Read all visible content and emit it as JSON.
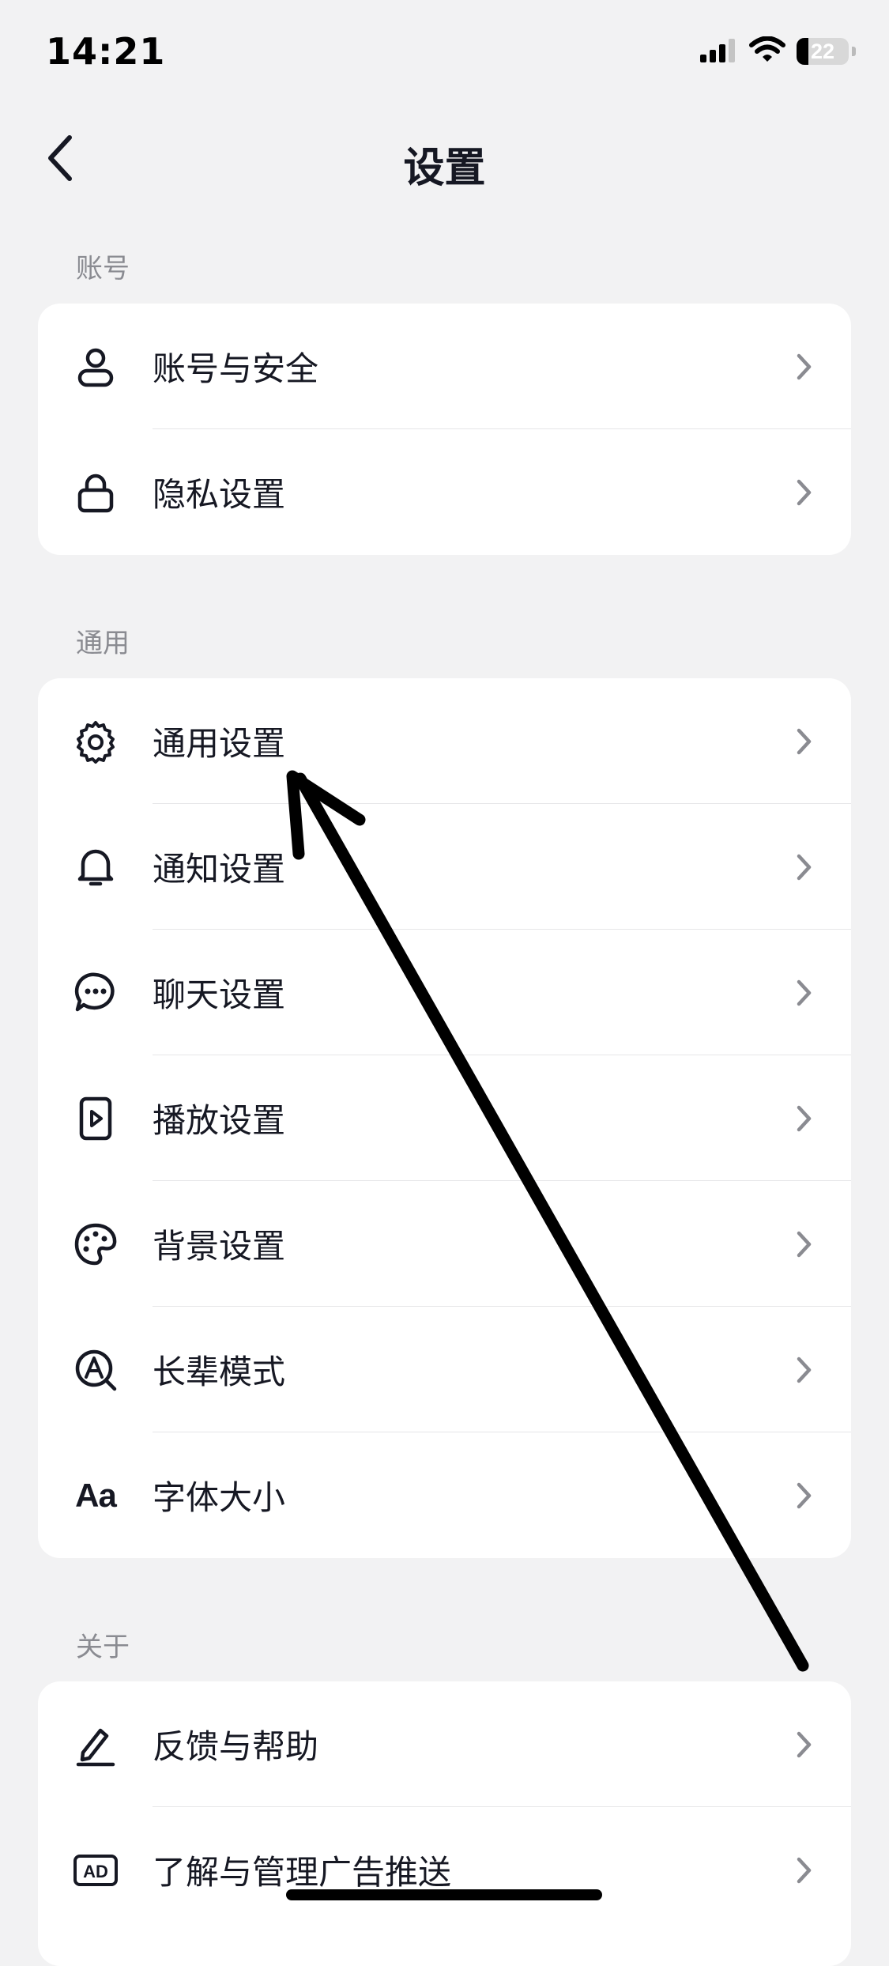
{
  "status_bar": {
    "time": "14:21",
    "battery": "22",
    "battery_level": 0.22,
    "signal_icon": "cellular-signal-icon",
    "wifi_icon": "wifi-icon"
  },
  "nav": {
    "title": "设置",
    "back_icon": "chevron-left-icon"
  },
  "sections": {
    "account": {
      "header": "账号",
      "items": [
        {
          "label": "账号与安全",
          "icon": "user-icon"
        },
        {
          "label": "隐私设置",
          "icon": "lock-icon"
        }
      ]
    },
    "general": {
      "header": "通用",
      "items": [
        {
          "label": "通用设置",
          "icon": "gear-icon"
        },
        {
          "label": "通知设置",
          "icon": "bell-icon"
        },
        {
          "label": "聊天设置",
          "icon": "chat-bubble-icon"
        },
        {
          "label": "播放设置",
          "icon": "play-icon"
        },
        {
          "label": "背景设置",
          "icon": "palette-icon"
        },
        {
          "label": "长辈模式",
          "icon": "elder-mode-icon"
        },
        {
          "label": "字体大小",
          "icon": "font-size-icon",
          "glyph": "Aa"
        }
      ]
    },
    "about": {
      "header": "关于",
      "items": [
        {
          "label": "反馈与帮助",
          "icon": "edit-pen-icon"
        },
        {
          "label": "了解与管理广告推送",
          "icon": "ad-icon",
          "glyph": "AD"
        }
      ]
    }
  },
  "colors": {
    "background": "#f2f2f3",
    "card": "#ffffff",
    "text": "#161823",
    "secondary_text": "#8a8b91",
    "divider": "#e6e6e8",
    "chevron": "#8a8b91",
    "annotation": "#000000"
  }
}
